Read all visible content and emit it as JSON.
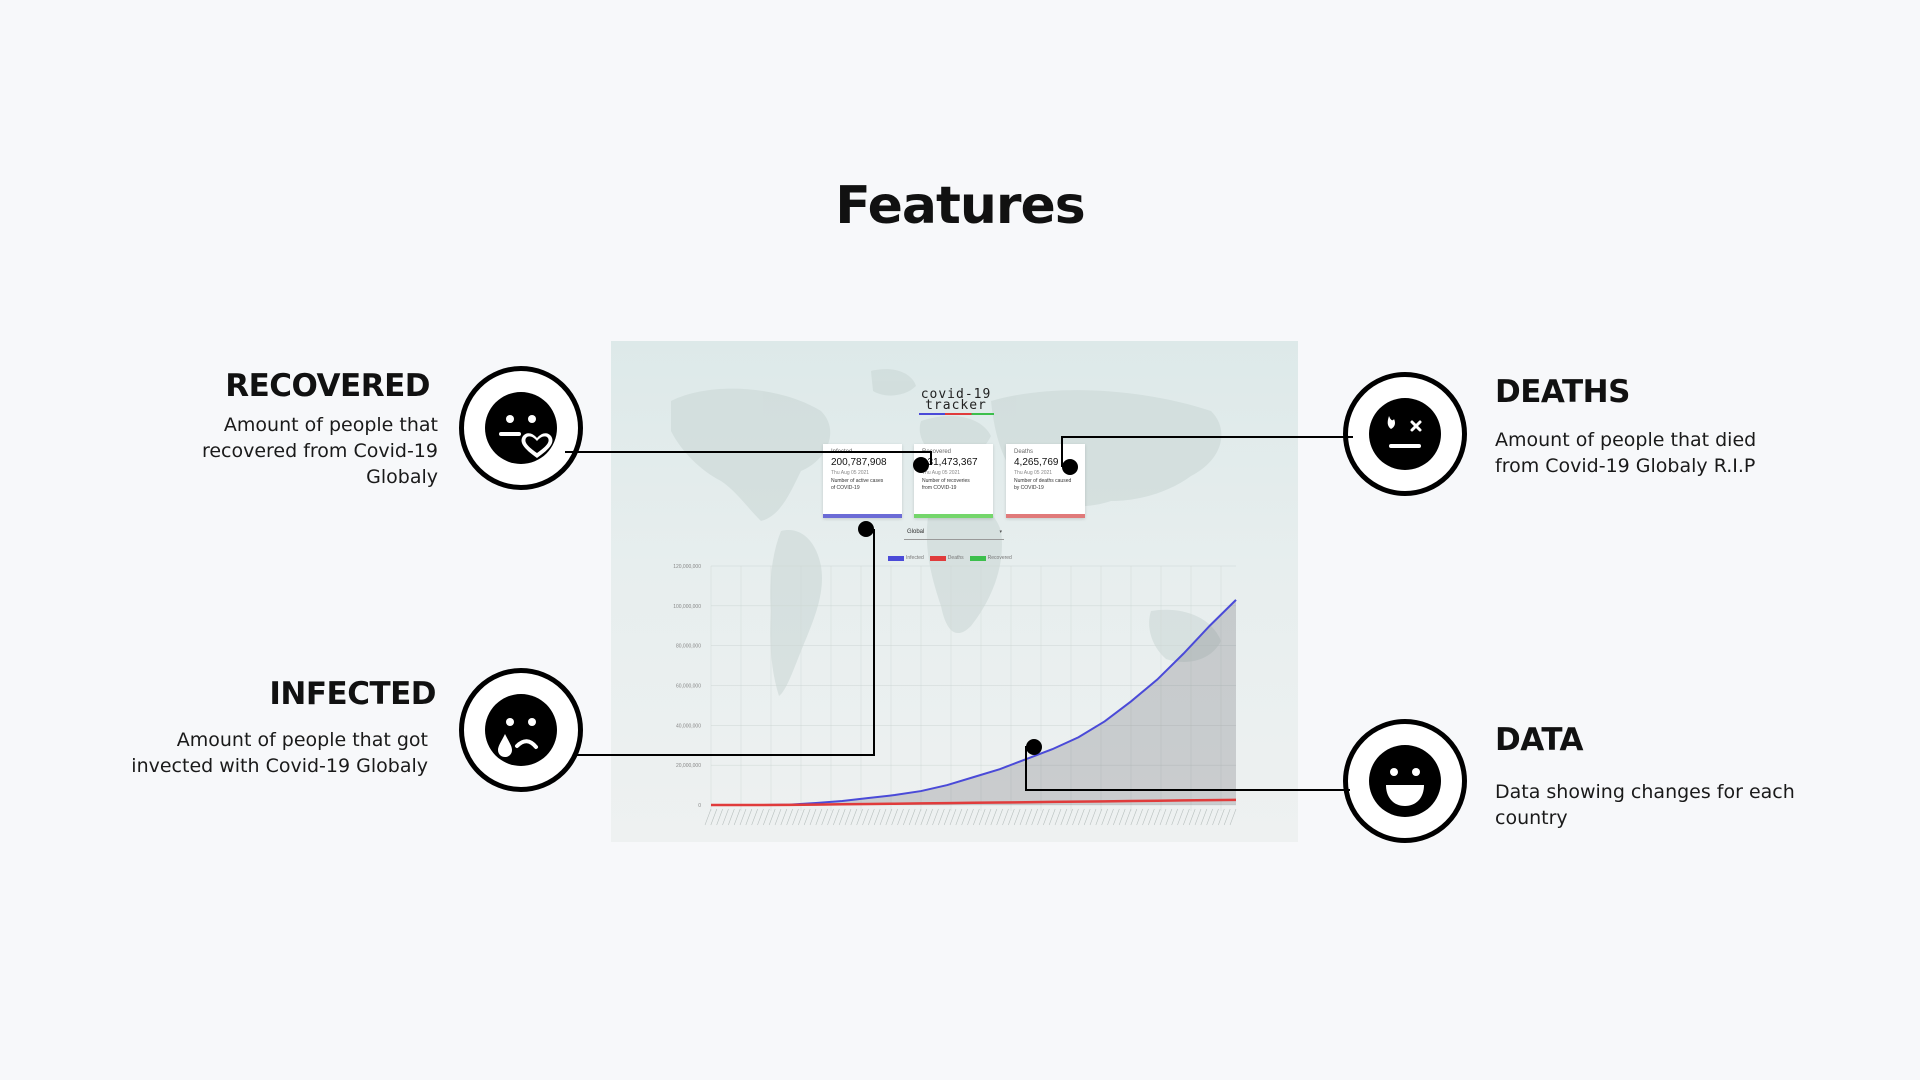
{
  "page": {
    "title": "Features"
  },
  "features": {
    "recovered": {
      "heading": "RECOVERED",
      "desc_lines": [
        "Amount of people that",
        "recovered from Covid-19",
        "Globaly"
      ],
      "icon": "smiling-face-with-heart-icon"
    },
    "infected": {
      "heading": "INFECTED",
      "desc_lines": [
        "Amount of people that got",
        "invected with Covid-19 Globaly"
      ],
      "icon": "crying-face-icon"
    },
    "deaths": {
      "heading": "DEATHS",
      "desc_lines": [
        "Amount of people that died",
        "from Covid-19 Globaly R.I.P"
      ],
      "icon": "dead-face-icon"
    },
    "data": {
      "heading": "DATA",
      "desc_lines": [
        "Data showing changes for each",
        "country"
      ],
      "icon": "grinning-face-icon"
    }
  },
  "app": {
    "logo_line1": "covid-19",
    "logo_line2": "tracker",
    "cards": [
      {
        "label": "Infected",
        "value": "200,787,908",
        "date": "Thu Aug 05 2021",
        "desc_lines": [
          "Number of active cases",
          "of COVID-19"
        ],
        "color": "#6b6bd6"
      },
      {
        "label": "Recovered",
        "value": "131,473,367",
        "date": "Thu Aug 05 2021",
        "desc_lines": [
          "Number of recoveries",
          "from COVID-19"
        ],
        "color": "#74d66b"
      },
      {
        "label": "Deaths",
        "value": "4,265,769",
        "date": "Thu Aug 05 2021",
        "desc_lines": [
          "Number of deaths caused",
          "by COVID-19"
        ],
        "color": "#e07a7a"
      }
    ],
    "country_select": {
      "value": "Global",
      "arrow": "▾"
    },
    "legend": [
      {
        "name": "Infected",
        "color": "#4a4ad8"
      },
      {
        "name": "Deaths",
        "color": "#e03b3b"
      },
      {
        "name": "Recovered",
        "color": "#3cbf4c"
      }
    ]
  },
  "chart_data": {
    "type": "line",
    "title": "",
    "xlabel": "",
    "ylabel": "",
    "ylim": [
      0,
      120000000
    ],
    "yticks": [
      0,
      20000000,
      40000000,
      60000000,
      80000000,
      100000000,
      120000000
    ],
    "ytick_labels": [
      "0",
      "20,000,000",
      "40,000,000",
      "60,000,000",
      "80,000,000",
      "100,000,000",
      "120,000,000"
    ],
    "x": [
      0,
      5,
      10,
      15,
      20,
      25,
      30,
      35,
      40,
      45,
      50,
      55,
      60,
      65,
      70,
      75,
      80,
      85,
      90,
      95,
      100
    ],
    "series": [
      {
        "name": "Infected",
        "color": "#4a4ad8",
        "values": [
          0,
          0,
          0,
          200000,
          1000000,
          2000000,
          3500000,
          5000000,
          7000000,
          10000000,
          14000000,
          18000000,
          23000000,
          28000000,
          34000000,
          42000000,
          52000000,
          63000000,
          76000000,
          90000000,
          103000000
        ]
      },
      {
        "name": "Deaths",
        "color": "#e03b3b",
        "values": [
          0,
          0,
          0,
          50000,
          200000,
          350000,
          500000,
          650000,
          800000,
          950000,
          1100000,
          1250000,
          1400000,
          1550000,
          1700000,
          1850000,
          2000000,
          2150000,
          2300000,
          2450000,
          2600000
        ]
      }
    ]
  }
}
